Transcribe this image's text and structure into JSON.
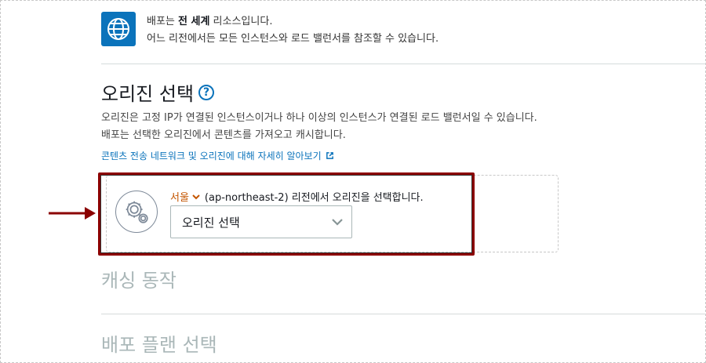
{
  "info": {
    "line1_prefix": "배포는 ",
    "line1_bold": "전 세계",
    "line1_suffix": " 리소스입니다.",
    "line2": "어느 리전에서든 모든 인스턴스와 로드 밸런서를 참조할 수 있습니다.",
    "icon": "globe-icon"
  },
  "origin_section": {
    "title": "오리진 선택",
    "help_label": "?",
    "description": "오리진은 고정 IP가 연결된 인스턴스이거나 하나 이상의 인스턴스가 연결된 로드 밸런서일 수 있습니다. 배포는 선택한 오리진에서 콘텐츠를 가져오고 캐시합니다.",
    "learn_more": "콘텐츠 전송 네트워크 및 오리진에 대해 자세히 알아보기",
    "region_name": "서울",
    "region_text": "(ap-northeast-2) 리전에서 오리진을 선택합니다.",
    "select_value": "오리진 선택"
  },
  "sections": {
    "caching": "캐싱 동작",
    "plan": "배포 플랜 선택"
  },
  "colors": {
    "accent": "#0b73bb",
    "region": "#c45500",
    "highlight": "#8b0000"
  }
}
